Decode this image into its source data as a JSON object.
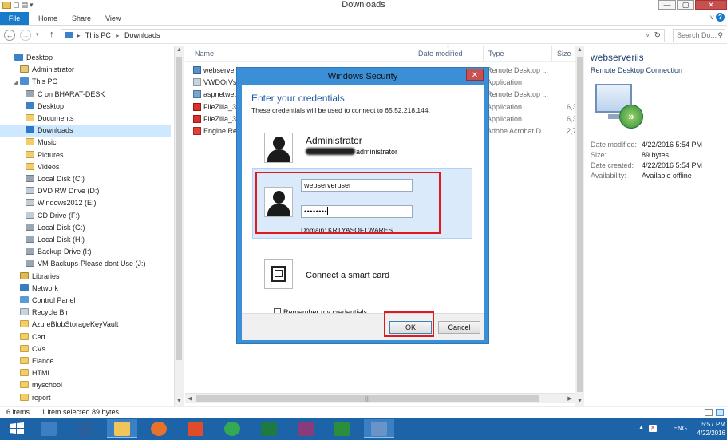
{
  "window": {
    "title": "Downloads"
  },
  "ribbon": {
    "tabs": [
      "File",
      "Home",
      "Share",
      "View"
    ]
  },
  "address": {
    "crumbs": [
      "This PC",
      "Downloads"
    ],
    "search_placeholder": "Search Do..."
  },
  "tree": [
    {
      "label": "Desktop",
      "icon": "desk"
    },
    {
      "label": "Administrator",
      "icon": "user"
    },
    {
      "label": "This PC",
      "icon": "pc"
    },
    {
      "label": "C on BHARAT-DESK",
      "icon": "drive"
    },
    {
      "label": "Desktop",
      "icon": "desk"
    },
    {
      "label": "Documents",
      "icon": "fold"
    },
    {
      "label": "Downloads",
      "icon": "blue"
    },
    {
      "label": "Music",
      "icon": "music"
    },
    {
      "label": "Pictures",
      "icon": "fold"
    },
    {
      "label": "Videos",
      "icon": "fold"
    },
    {
      "label": "Local Disk (C:)",
      "icon": "drive"
    },
    {
      "label": "DVD RW Drive (D:)",
      "icon": "dvd"
    },
    {
      "label": "Windows2012 (E:)",
      "icon": "dvd"
    },
    {
      "label": "CD Drive (F:)",
      "icon": "dvd"
    },
    {
      "label": "Local Disk (G:)",
      "icon": "drive"
    },
    {
      "label": "Local Disk (H:)",
      "icon": "drive"
    },
    {
      "label": "Backup-Drive (I:)",
      "icon": "drive"
    },
    {
      "label": "VM-Backups-Please dont Use (J:)",
      "icon": "drive"
    },
    {
      "label": "Libraries",
      "icon": "lib"
    },
    {
      "label": "Network",
      "icon": "net"
    },
    {
      "label": "Control Panel",
      "icon": "cpl"
    },
    {
      "label": "Recycle Bin",
      "icon": "bin"
    },
    {
      "label": "AzureBlobStorageKeyVault",
      "icon": "fold"
    },
    {
      "label": "Cert",
      "icon": "fold"
    },
    {
      "label": "CVs",
      "icon": "fold"
    },
    {
      "label": "Elance",
      "icon": "fold"
    },
    {
      "label": "HTML",
      "icon": "fold"
    },
    {
      "label": "myschool",
      "icon": "fold"
    },
    {
      "label": "report",
      "icon": "fold"
    }
  ],
  "columns": {
    "name": "Name",
    "date": "Date modified",
    "type": "Type",
    "size": "Size"
  },
  "files": [
    {
      "name": "webserveriis",
      "type": "Remote Desktop ...",
      "size": "",
      "icon": "rdp"
    },
    {
      "name": "VWDOrVs2013AzureAuthoringTools",
      "type": "Application",
      "size": "",
      "icon": "exe"
    },
    {
      "name": "aspnetwebfxtools",
      "type": "Remote Desktop ...",
      "size": "",
      "icon": "asp"
    },
    {
      "name": "FileZilla_3",
      "type": "Application",
      "size": "6,3",
      "icon": "fz"
    },
    {
      "name": "FileZilla_3",
      "type": "Application",
      "size": "6,3",
      "icon": "fz"
    },
    {
      "name": "Engine Re",
      "type": "Adobe Acrobat D...",
      "size": "2,7",
      "icon": "pdf"
    }
  ],
  "details": {
    "name": "webserveriis",
    "type": "Remote Desktop Connection",
    "rows": [
      {
        "k": "Date modified:",
        "v": "4/22/2016 5:54 PM"
      },
      {
        "k": "Size:",
        "v": "89 bytes"
      },
      {
        "k": "Date created:",
        "v": "4/22/2016 5:54 PM"
      },
      {
        "k": "Availability:",
        "v": "Available offline"
      }
    ]
  },
  "status": {
    "items": "6 items",
    "selected": "1 item selected  89 bytes"
  },
  "dialog": {
    "title": "Windows Security",
    "heading": "Enter your credentials",
    "subtext": "These credentials will be used to connect to 65.52.218.144.",
    "account1_name": "Administrator",
    "account1_sub": "administrator",
    "username": "webserveruser",
    "password": "••••••••",
    "domain": "Domain: KRTYASOFTWARES",
    "smartcard": "Connect a smart card",
    "remember": "Remember my credentials",
    "ok": "OK",
    "cancel": "Cancel"
  },
  "taskbar": {
    "apps": [
      {
        "name": "server-manager",
        "color": "#3d7fc0"
      },
      {
        "name": "powershell",
        "color": "#2a5f9e"
      },
      {
        "name": "file-explorer",
        "color": "#f0c65a"
      },
      {
        "name": "firefox",
        "color": "#e8712b"
      },
      {
        "name": "apps-grid",
        "color": "#e04b2a"
      },
      {
        "name": "chrome",
        "color": "#35a853"
      },
      {
        "name": "excel",
        "color": "#1d7a42"
      },
      {
        "name": "winrar",
        "color": "#8a3b7b"
      },
      {
        "name": "visual-studio",
        "color": "#2a8f3c"
      },
      {
        "name": "remote-desktop",
        "color": "#6a94c8"
      }
    ],
    "lang": "ENG",
    "time": "5:57 PM",
    "date": "4/22/2016"
  }
}
